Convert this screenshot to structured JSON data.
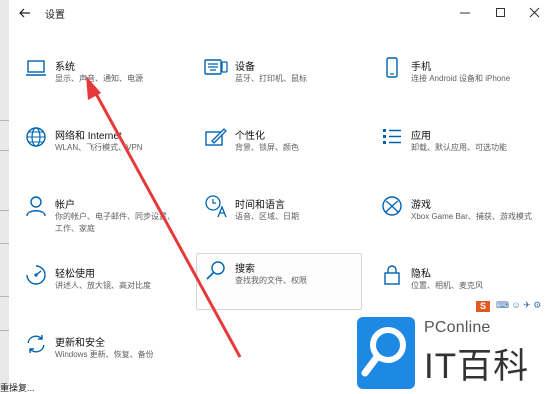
{
  "window": {
    "title": "设置"
  },
  "tiles": [
    {
      "id": "system",
      "name": "系统",
      "desc": "显示、声音、通知、电源",
      "icon": "laptop-icon"
    },
    {
      "id": "devices",
      "name": "设备",
      "desc": "蓝牙、打印机、鼠标",
      "icon": "keyboard-icon"
    },
    {
      "id": "phone",
      "name": "手机",
      "desc": "连接 Android 设备和 iPhone",
      "icon": "phone-icon"
    },
    {
      "id": "network",
      "name": "网络和 Internet",
      "desc": "WLAN、飞行模式、VPN",
      "icon": "globe-icon"
    },
    {
      "id": "personalization",
      "name": "个性化",
      "desc": "背景、锁屏、颜色",
      "icon": "paint-brush-icon"
    },
    {
      "id": "apps",
      "name": "应用",
      "desc": "卸载、默认应用、可选功能",
      "icon": "apps-list-icon"
    },
    {
      "id": "accounts",
      "name": "帐户",
      "desc": "你的帐户、电子邮件、同步设置、工作、家庭",
      "icon": "person-icon"
    },
    {
      "id": "time-language",
      "name": "时间和语言",
      "desc": "语音、区域、日期",
      "icon": "time-language-icon"
    },
    {
      "id": "gaming",
      "name": "游戏",
      "desc": "Xbox Game Bar、捕获、游戏模式",
      "icon": "xbox-icon"
    },
    {
      "id": "ease-of-access",
      "name": "轻松使用",
      "desc": "讲述人、放大镜、高对比度",
      "icon": "ease-of-access-icon"
    },
    {
      "id": "search",
      "name": "搜索",
      "desc": "查找我的文件、权限",
      "icon": "search-icon"
    },
    {
      "id": "privacy",
      "name": "隐私",
      "desc": "位置、相机、麦克风",
      "icon": "lock-icon"
    },
    {
      "id": "update-security",
      "name": "更新和安全",
      "desc": "Windows 更新、恢复、备份",
      "icon": "sync-icon"
    }
  ],
  "watermark": {
    "brand": "PConline",
    "title": "IT百科"
  },
  "tray": {
    "badge": "S"
  },
  "bottom_text": "重操复...",
  "colors": {
    "accent": "#0063b1",
    "arrow": "#e8393a",
    "watermark_blue": "#1e88e5"
  }
}
